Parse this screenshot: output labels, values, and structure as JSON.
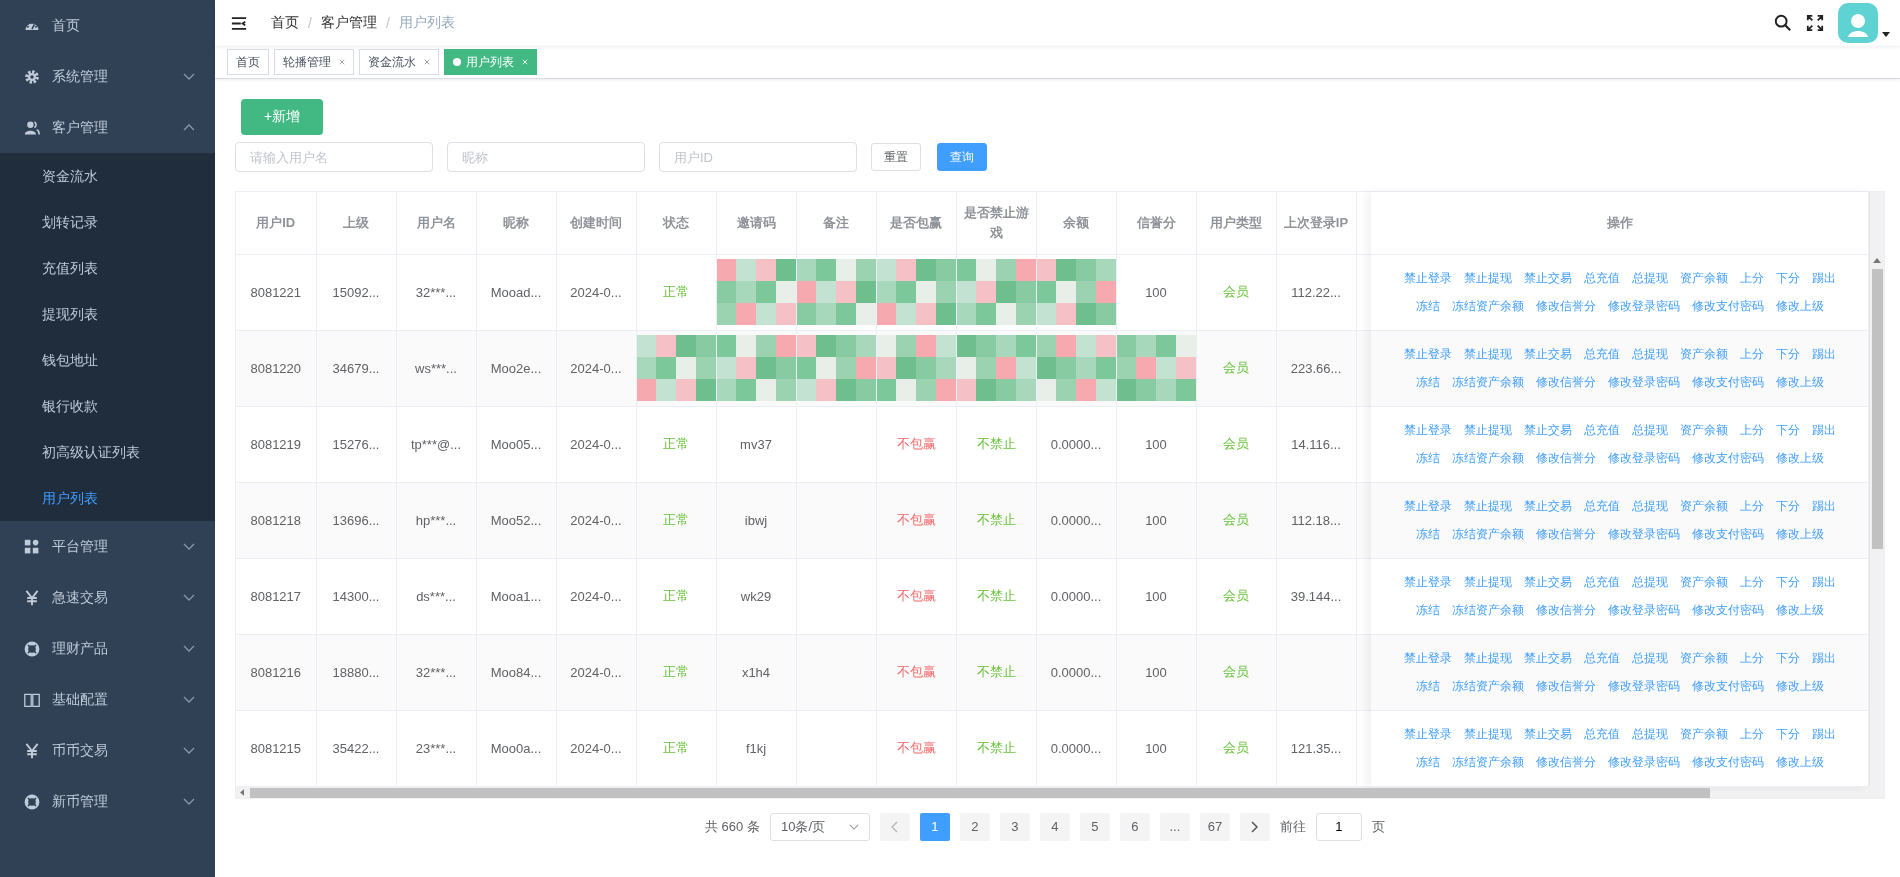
{
  "sidebar": {
    "items": [
      {
        "label": "首页",
        "kind": "dashboard"
      },
      {
        "label": "系统管理",
        "kind": "gear",
        "expanded": false
      },
      {
        "label": "客户管理",
        "kind": "users",
        "expanded": true,
        "children": [
          {
            "label": "资金流水",
            "selected": false
          },
          {
            "label": "划转记录",
            "selected": false
          },
          {
            "label": "充值列表",
            "selected": false
          },
          {
            "label": "提现列表",
            "selected": false
          },
          {
            "label": "钱包地址",
            "selected": false
          },
          {
            "label": "银行收款",
            "selected": false
          },
          {
            "label": "初高级认证列表",
            "selected": false
          },
          {
            "label": "用户列表",
            "selected": true
          }
        ]
      },
      {
        "label": "平台管理",
        "kind": "grid",
        "expanded": false
      },
      {
        "label": "急速交易",
        "kind": "yen",
        "expanded": false
      },
      {
        "label": "理财产品",
        "kind": "ring",
        "expanded": false
      },
      {
        "label": "基础配置",
        "kind": "book",
        "expanded": false
      },
      {
        "label": "币币交易",
        "kind": "yen",
        "expanded": false
      },
      {
        "label": "新币管理",
        "kind": "ring",
        "expanded": false
      }
    ]
  },
  "breadcrumb": {
    "separator": "/",
    "items": [
      "首页",
      "客户管理",
      "用户列表"
    ]
  },
  "tabs": [
    {
      "label": "首页",
      "selected": false,
      "closable": false
    },
    {
      "label": "轮播管理",
      "selected": false,
      "closable": true
    },
    {
      "label": "资金流水",
      "selected": false,
      "closable": true
    },
    {
      "label": "用户列表",
      "selected": true,
      "closable": true
    }
  ],
  "add_button": "+新增",
  "filters": {
    "fields": [
      {
        "placeholder": "请输入用户名"
      },
      {
        "placeholder": "昵称"
      },
      {
        "placeholder": "用户ID"
      }
    ],
    "reset_button": "重置",
    "search_button": "查询"
  },
  "table": {
    "columns": [
      {
        "label": "用户ID",
        "kind": "plain"
      },
      {
        "label": "上级",
        "kind": "plain"
      },
      {
        "label": "用户名",
        "kind": "plain"
      },
      {
        "label": "昵称",
        "kind": "plain"
      },
      {
        "label": "创建时间",
        "kind": "plain"
      },
      {
        "label": "状态",
        "kind": "positive"
      },
      {
        "label": "邀请码",
        "kind": "plain"
      },
      {
        "label": "备注",
        "kind": "plain"
      },
      {
        "label": "是否包赢",
        "kind": "negative"
      },
      {
        "label": "是否禁止游戏",
        "kind": "positive"
      },
      {
        "label": "余额",
        "kind": "plain"
      },
      {
        "label": "信誉分",
        "kind": "plain"
      },
      {
        "label": "用户类型",
        "kind": "positive"
      },
      {
        "label": "上次登录IP",
        "kind": "plain"
      }
    ],
    "actions_label": "操作",
    "rows": [
      {
        "cells": [
          {
            "text": "8081221"
          },
          {
            "text": "15092..."
          },
          {
            "text": "32***..."
          },
          {
            "text": "Mooad..."
          },
          {
            "text": "2024-0..."
          },
          {
            "text": "正常"
          },
          {
            "redacted": true
          },
          {
            "redacted": true
          },
          {
            "redacted": true
          },
          {
            "redacted": true
          },
          {
            "redacted": true
          },
          {
            "text": "100"
          },
          {
            "text": "会员"
          },
          {
            "text": "112.22..."
          }
        ],
        "actions": [
          [
            "禁止登录",
            "禁止提现",
            "禁止交易",
            "总充值",
            "总提现",
            "资产余额",
            "上分",
            "下分",
            "踢出"
          ],
          [
            "冻结",
            "冻结资产余额",
            "修改信誉分",
            "修改登录密码",
            "修改支付密码",
            "修改上级"
          ]
        ]
      },
      {
        "cells": [
          {
            "text": "8081220"
          },
          {
            "text": "34679..."
          },
          {
            "text": "ws***..."
          },
          {
            "text": "Moo2e..."
          },
          {
            "text": "2024-0..."
          },
          {
            "redacted": true
          },
          {
            "redacted": true
          },
          {
            "redacted": true
          },
          {
            "redacted": true
          },
          {
            "redacted": true
          },
          {
            "redacted": true
          },
          {
            "redacted": true
          },
          {
            "text": "会员"
          },
          {
            "text": "223.66..."
          }
        ],
        "actions": [
          [
            "禁止登录",
            "禁止提现",
            "禁止交易",
            "总充值",
            "总提现",
            "资产余额",
            "上分",
            "下分",
            "踢出"
          ],
          [
            "冻结",
            "冻结资产余额",
            "修改信誉分",
            "修改登录密码",
            "修改支付密码",
            "修改上级"
          ]
        ]
      },
      {
        "cells": [
          {
            "text": "8081219"
          },
          {
            "text": "15276..."
          },
          {
            "text": "tp***@..."
          },
          {
            "text": "Moo05..."
          },
          {
            "text": "2024-0..."
          },
          {
            "text": "正常"
          },
          {
            "text": "mv37"
          },
          {},
          {
            "text": "不包赢"
          },
          {
            "text": "不禁止"
          },
          {
            "text": "0.0000..."
          },
          {
            "text": "100"
          },
          {
            "text": "会员"
          },
          {
            "text": "14.116..."
          }
        ],
        "actions": [
          [
            "禁止登录",
            "禁止提现",
            "禁止交易",
            "总充值",
            "总提现",
            "资产余额",
            "上分",
            "下分",
            "踢出"
          ],
          [
            "冻结",
            "冻结资产余额",
            "修改信誉分",
            "修改登录密码",
            "修改支付密码",
            "修改上级"
          ]
        ]
      },
      {
        "cells": [
          {
            "text": "8081218"
          },
          {
            "text": "13696..."
          },
          {
            "text": "hp***..."
          },
          {
            "text": "Moo52..."
          },
          {
            "text": "2024-0..."
          },
          {
            "text": "正常"
          },
          {
            "text": "ibwj"
          },
          {},
          {
            "text": "不包赢"
          },
          {
            "text": "不禁止"
          },
          {
            "text": "0.0000..."
          },
          {
            "text": "100"
          },
          {
            "text": "会员"
          },
          {
            "text": "112.18..."
          }
        ],
        "actions": [
          [
            "禁止登录",
            "禁止提现",
            "禁止交易",
            "总充值",
            "总提现",
            "资产余额",
            "上分",
            "下分",
            "踢出"
          ],
          [
            "冻结",
            "冻结资产余额",
            "修改信誉分",
            "修改登录密码",
            "修改支付密码",
            "修改上级"
          ]
        ]
      },
      {
        "cells": [
          {
            "text": "8081217"
          },
          {
            "text": "14300..."
          },
          {
            "text": "ds***..."
          },
          {
            "text": "Mooa1..."
          },
          {
            "text": "2024-0..."
          },
          {
            "text": "正常"
          },
          {
            "text": "wk29"
          },
          {},
          {
            "text": "不包赢"
          },
          {
            "text": "不禁止"
          },
          {
            "text": "0.0000..."
          },
          {
            "text": "100"
          },
          {
            "text": "会员"
          },
          {
            "text": "39.144..."
          }
        ],
        "actions": [
          [
            "禁止登录",
            "禁止提现",
            "禁止交易",
            "总充值",
            "总提现",
            "资产余额",
            "上分",
            "下分",
            "踢出"
          ],
          [
            "冻结",
            "冻结资产余额",
            "修改信誉分",
            "修改登录密码",
            "修改支付密码",
            "修改上级"
          ]
        ]
      },
      {
        "cells": [
          {
            "text": "8081216"
          },
          {
            "text": "18880..."
          },
          {
            "text": "32***..."
          },
          {
            "text": "Moo84..."
          },
          {
            "text": "2024-0..."
          },
          {
            "text": "正常"
          },
          {
            "text": "x1h4"
          },
          {},
          {
            "text": "不包赢"
          },
          {
            "text": "不禁止"
          },
          {
            "text": "0.0000..."
          },
          {
            "text": "100"
          },
          {
            "text": "会员"
          },
          {}
        ],
        "actions": [
          [
            "禁止登录",
            "禁止提现",
            "禁止交易",
            "总充值",
            "总提现",
            "资产余额",
            "上分",
            "下分",
            "踢出"
          ],
          [
            "冻结",
            "冻结资产余额",
            "修改信誉分",
            "修改登录密码",
            "修改支付密码",
            "修改上级"
          ]
        ]
      },
      {
        "cells": [
          {
            "text": "8081215"
          },
          {
            "text": "35422..."
          },
          {
            "text": "23***..."
          },
          {
            "text": "Moo0a..."
          },
          {
            "text": "2024-0..."
          },
          {
            "text": "正常"
          },
          {
            "text": "f1kj"
          },
          {},
          {
            "text": "不包赢"
          },
          {
            "text": "不禁止"
          },
          {
            "text": "0.0000..."
          },
          {
            "text": "100"
          },
          {
            "text": "会员"
          },
          {
            "text": "121.35..."
          }
        ],
        "actions": [
          [
            "禁止登录",
            "禁止提现",
            "禁止交易",
            "总充值",
            "总提现",
            "资产余额",
            "上分",
            "下分",
            "踢出"
          ],
          [
            "冻结",
            "冻结资产余额",
            "修改信誉分",
            "修改登录密码",
            "修改支付密码",
            "修改上级"
          ]
        ]
      }
    ]
  },
  "pagination": {
    "total": "共 660 条",
    "page_size": "10条/页",
    "pages": [
      {
        "label": "1",
        "selected": true
      },
      {
        "label": "2",
        "selected": false
      },
      {
        "label": "3",
        "selected": false
      },
      {
        "label": "4",
        "selected": false
      },
      {
        "label": "5",
        "selected": false
      },
      {
        "label": "6",
        "selected": false
      },
      {
        "label": "...",
        "selected": false
      },
      {
        "label": "67",
        "selected": false
      }
    ],
    "goto_label": "前往",
    "goto_value": "1",
    "goto_suffix": "页"
  }
}
